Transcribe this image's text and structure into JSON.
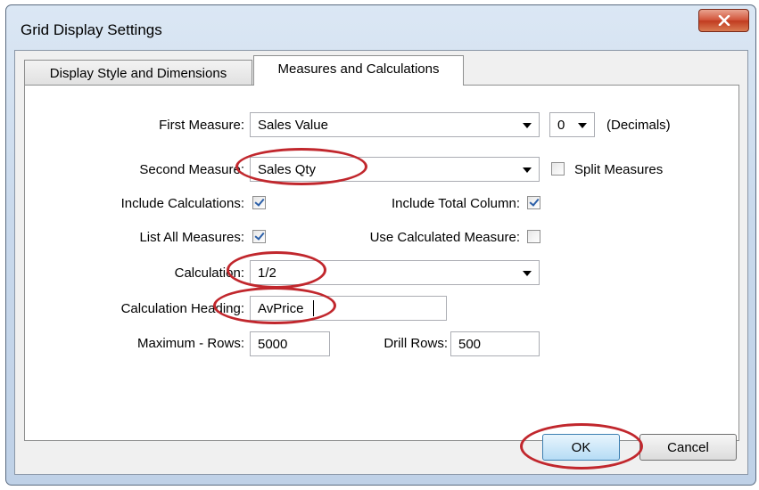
{
  "window": {
    "title": "Grid Display Settings",
    "close_label": "x"
  },
  "tabs": [
    {
      "label": "Display Style and Dimensions",
      "active": false
    },
    {
      "label": "Measures and Calculations",
      "active": true
    }
  ],
  "form": {
    "first_measure": {
      "label": "First Measure:",
      "value": "Sales Value"
    },
    "decimals": {
      "value": "0",
      "label": "(Decimals)"
    },
    "second_measure": {
      "label": "Second Measure:",
      "value": "Sales Qty"
    },
    "split_measures": {
      "label": "Split Measures",
      "checked": false
    },
    "include_calculations": {
      "label": "Include Calculations:",
      "checked": true
    },
    "include_total_column": {
      "label": "Include Total Column:",
      "checked": true
    },
    "list_all_measures": {
      "label": "List All Measures:",
      "checked": true
    },
    "use_calculated_measure": {
      "label": "Use Calculated Measure:",
      "checked": false
    },
    "calculation": {
      "label": "Calculation:",
      "value": "1/2"
    },
    "calculation_heading": {
      "label": "Calculation Heading:",
      "value": "AvPrice"
    },
    "maximum_rows": {
      "label": "Maximum - Rows:",
      "value": "5000"
    },
    "drill_rows": {
      "label": "Drill Rows:",
      "value": "500"
    }
  },
  "buttons": {
    "ok": "OK",
    "cancel": "Cancel"
  },
  "colors": {
    "annotation": "#c1272d",
    "accent": "#2b5fa8"
  }
}
